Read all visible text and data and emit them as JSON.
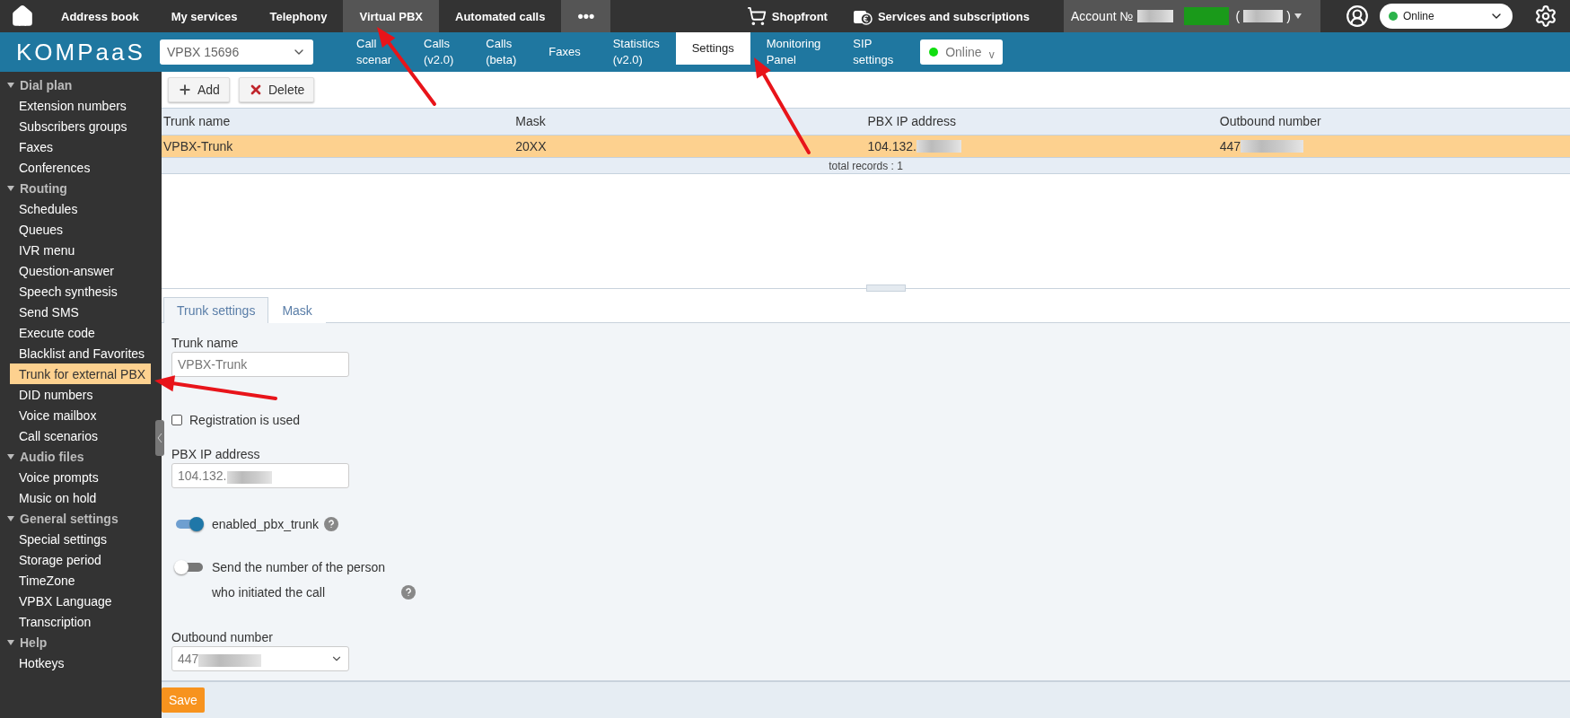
{
  "top_nav": {
    "items": [
      {
        "label": "Address book",
        "selected": false
      },
      {
        "label": "My services",
        "selected": false
      },
      {
        "label": "Telephony",
        "selected": false
      },
      {
        "label": "Virtual PBX",
        "selected": true
      },
      {
        "label": "Automated calls",
        "selected": false
      }
    ],
    "more": "•••",
    "shopfront": "Shopfront",
    "services": "Services and subscriptions",
    "account": {
      "label": "Account №",
      "open": "(",
      "close": ")"
    },
    "status": "Online"
  },
  "header": {
    "logo": "KOMPaaS",
    "vpbx_select": "VPBX 15696",
    "tabs": [
      {
        "label": "Call\nscenar",
        "selected": false
      },
      {
        "label": "Calls\n(v2.0)",
        "selected": false
      },
      {
        "label": "Calls\n(beta)",
        "selected": false
      },
      {
        "label": "Faxes",
        "selected": false
      },
      {
        "label": "Statistics\n(v2.0)",
        "selected": false
      },
      {
        "label": "Settings",
        "selected": true
      },
      {
        "label": "Monitoring\nPanel",
        "selected": false
      },
      {
        "label": "SIP\nsettings",
        "selected": false
      }
    ],
    "status": "Online",
    "status_caret": "v"
  },
  "sidebar": {
    "groups": [
      {
        "label": "Dial plan",
        "expanded": true,
        "children": [
          {
            "label": "Extension numbers",
            "selected": false
          },
          {
            "label": "Subscribers groups",
            "selected": false
          },
          {
            "label": "Faxes",
            "selected": false
          },
          {
            "label": "Conferences",
            "selected": false
          }
        ]
      },
      {
        "label": "Routing",
        "expanded": true,
        "children": [
          {
            "label": "Schedules",
            "selected": false
          },
          {
            "label": "Queues",
            "selected": false
          },
          {
            "label": "IVR menu",
            "selected": false
          },
          {
            "label": "Question-answer",
            "selected": false
          },
          {
            "label": "Speech synthesis",
            "selected": false
          },
          {
            "label": "Send SMS",
            "selected": false
          },
          {
            "label": "Execute code",
            "selected": false
          },
          {
            "label": "Blacklist and Favorites",
            "selected": false
          },
          {
            "label": "Trunk for external PBX",
            "selected": true
          },
          {
            "label": "DID numbers",
            "selected": false
          },
          {
            "label": "Voice mailbox",
            "selected": false
          },
          {
            "label": "Call scenarios",
            "selected": false
          }
        ]
      },
      {
        "label": "Audio files",
        "expanded": true,
        "children": [
          {
            "label": "Voice prompts",
            "selected": false
          },
          {
            "label": "Music on hold",
            "selected": false
          }
        ]
      },
      {
        "label": "General settings",
        "expanded": true,
        "children": [
          {
            "label": "Special settings",
            "selected": false
          },
          {
            "label": "Storage period",
            "selected": false
          },
          {
            "label": "TimeZone",
            "selected": false
          },
          {
            "label": "VPBX Language",
            "selected": false
          },
          {
            "label": "Transcription",
            "selected": false
          }
        ]
      },
      {
        "label": "Help",
        "expanded": true,
        "children": [
          {
            "label": "Hotkeys",
            "selected": false
          }
        ]
      }
    ]
  },
  "toolbar": {
    "add": "Add",
    "delete": "Delete"
  },
  "table": {
    "columns": [
      "Trunk name",
      "Mask",
      "PBX IP address",
      "Outbound number"
    ],
    "rows": [
      {
        "selected": true,
        "cells": [
          {
            "text": "VPBX-Trunk",
            "blurred": false
          },
          {
            "text": "20XX",
            "blurred": false
          },
          {
            "text": "104.132.",
            "blurred": true
          },
          {
            "text": "447",
            "blurred": true
          }
        ]
      }
    ],
    "footer": "total records : 1"
  },
  "form_tabs": [
    {
      "label": "Trunk settings",
      "selected": true
    },
    {
      "label": "Mask",
      "selected": false
    }
  ],
  "form": [
    {
      "kind": "text",
      "label": "Trunk name",
      "value": "VPBX-Trunk",
      "blurred": false
    },
    {
      "kind": "checkbox",
      "label": "Registration is used",
      "checked": false
    },
    {
      "kind": "text",
      "label": "PBX IP address",
      "value": "104.132.",
      "blurred": true
    },
    {
      "kind": "toggle",
      "label": "enabled_pbx_trunk",
      "on": true,
      "help": true
    },
    {
      "kind": "toggle",
      "label": "Send the number of the person who initiated the call",
      "on": false,
      "help": true
    },
    {
      "kind": "select",
      "label": "Outbound number",
      "value": "447",
      "blurred": true
    }
  ],
  "save": "Save"
}
